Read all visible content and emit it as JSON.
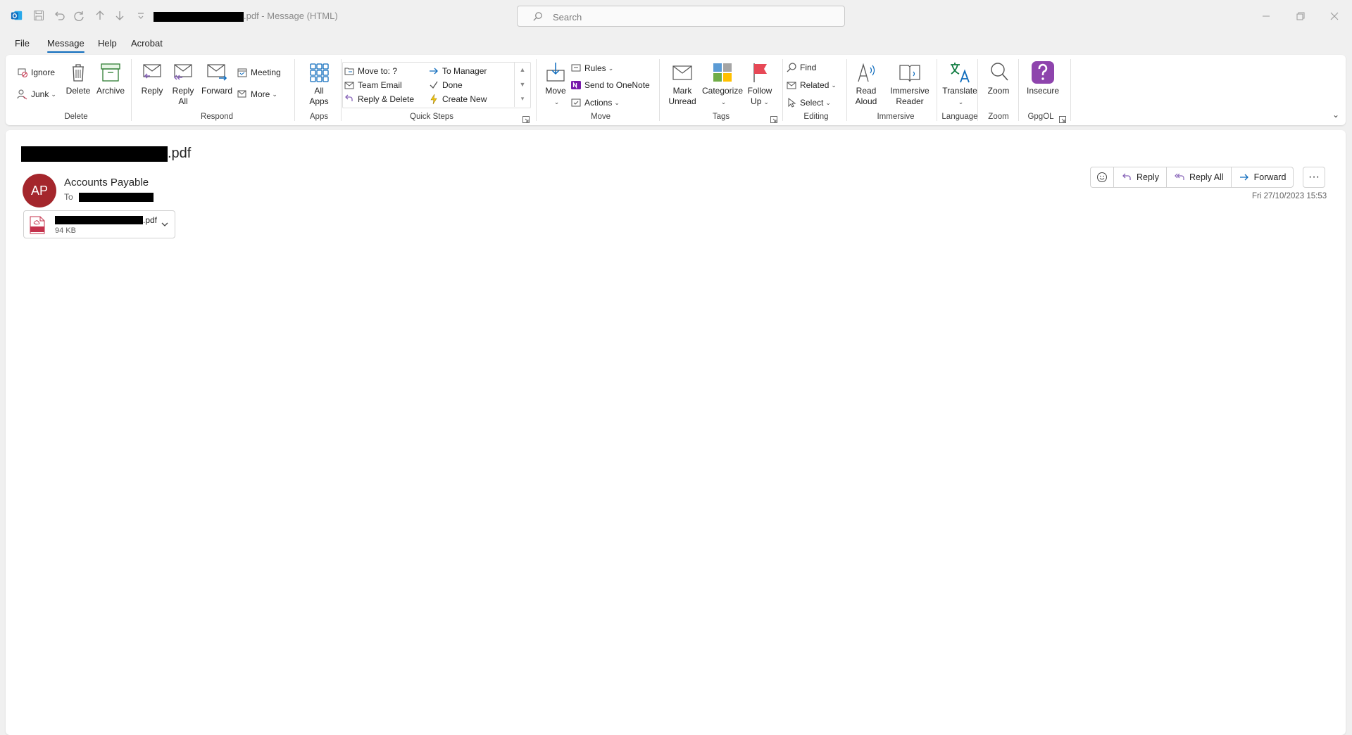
{
  "window": {
    "title_suffix": ".pdf",
    "title_rest": " - Message (HTML)",
    "search_placeholder": "Search"
  },
  "menu": {
    "tabs": [
      "File",
      "Message",
      "Help",
      "Acrobat"
    ],
    "active": "Message"
  },
  "ribbon": {
    "delete_group": {
      "label": "Delete",
      "ignore": "Ignore",
      "junk": "Junk",
      "delete": "Delete",
      "archive": "Archive"
    },
    "respond_group": {
      "label": "Respond",
      "reply": "Reply",
      "reply_all_1": "Reply",
      "reply_all_2": "All",
      "forward": "Forward",
      "meeting": "Meeting",
      "more": "More"
    },
    "apps_group": {
      "label": "Apps",
      "all_apps_1": "All",
      "all_apps_2": "Apps"
    },
    "quick_steps_group": {
      "label": "Quick Steps",
      "items": [
        "Move to: ?",
        "Team Email",
        "Reply & Delete",
        "To Manager",
        "Done",
        "Create New"
      ]
    },
    "move_group": {
      "label": "Move",
      "move": "Move",
      "rules": "Rules",
      "send_onenote": "Send to OneNote",
      "actions": "Actions"
    },
    "tags_group": {
      "label": "Tags",
      "mark_unread_1": "Mark",
      "mark_unread_2": "Unread",
      "categorize": "Categorize",
      "follow_up_1": "Follow",
      "follow_up_2": "Up"
    },
    "editing_group": {
      "label": "Editing",
      "find": "Find",
      "related": "Related",
      "select": "Select"
    },
    "immersive_group": {
      "label": "Immersive",
      "read_aloud_1": "Read",
      "read_aloud_2": "Aloud",
      "immersive_reader_1": "Immersive",
      "immersive_reader_2": "Reader"
    },
    "language_group": {
      "label": "Language",
      "translate": "Translate"
    },
    "zoom_group": {
      "label": "Zoom",
      "zoom": "Zoom"
    },
    "gpgol_group": {
      "label": "GpgOL",
      "insecure": "Insecure"
    }
  },
  "message": {
    "subject_suffix": ".pdf",
    "sender_initials": "AP",
    "sender_name": "Accounts Payable",
    "to_label": "To",
    "datetime": "Fri 27/10/2023 15:53",
    "attachment": {
      "name_suffix": ".pdf",
      "size": "94 KB"
    },
    "actions": {
      "reply": "Reply",
      "reply_all": "Reply All",
      "forward": "Forward",
      "more": "···"
    }
  },
  "colors": {
    "accent": "#0f6cbd",
    "avatar": "#a4262c",
    "insecure": "#8e44ad",
    "translate": "#107c41"
  }
}
